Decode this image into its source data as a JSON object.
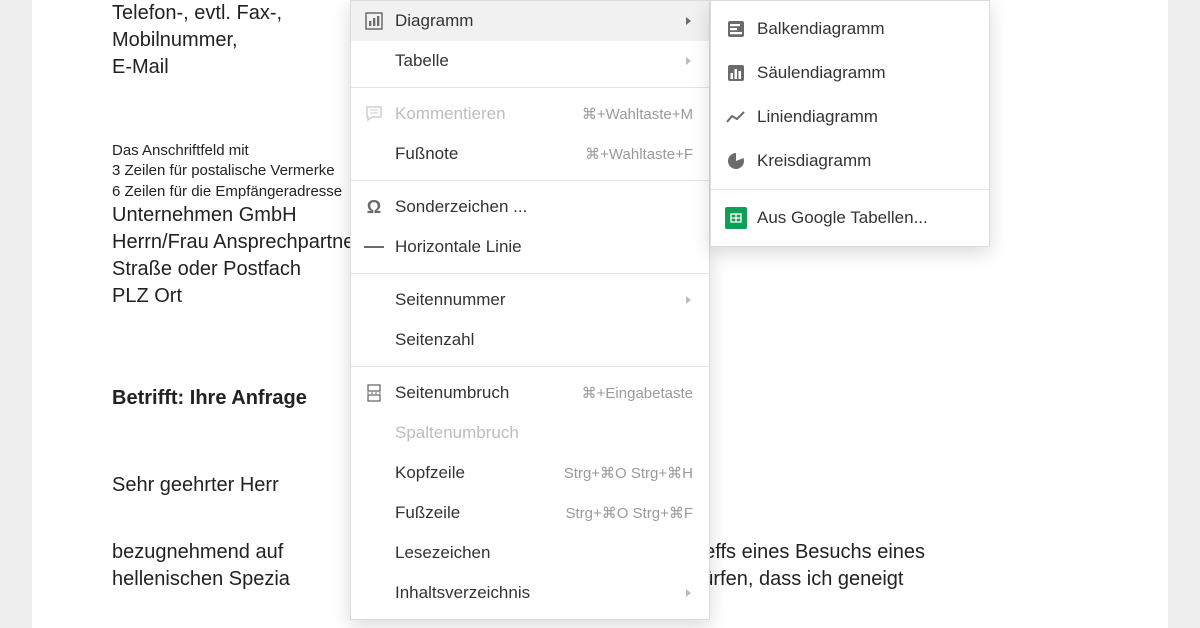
{
  "document": {
    "line1": "Telefon-, evtl. Fax-,",
    "line2": "Mobilnummer,",
    "line3": "E-Mail",
    "small1": "Das Anschriftfeld mit",
    "small2": "3 Zeilen für postalische Vermerke",
    "small3": "6 Zeilen für die Empfängeradresse",
    "addr1": "Unternehmen GmbH",
    "addr2": "Herrn/Frau Ansprechpartner",
    "addr3": "Straße oder Postfach",
    "addr4": "PLZ Ort",
    "subject": "Betrifft: Ihre Anfrage",
    "greeting": "Sehr geehrter Herr ",
    "body1": "bezugnehmend auf                                                    tigen Tage betreffs eines Besuchs eines",
    "body2": "hellenischen Spezia                                                  n mitteilen zu dürfen, dass ich geneigt"
  },
  "menu": {
    "diagramm": "Diagramm",
    "tabelle": "Tabelle",
    "kommentieren": "Kommentieren",
    "kommentieren_sc": "⌘+Wahltaste+M",
    "fussnote": "Fußnote",
    "fussnote_sc": "⌘+Wahltaste+F",
    "sonderzeichen": "Sonderzeichen ...",
    "hlinie": "Horizontale Linie",
    "seitennummer": "Seitennummer",
    "seitenzahl": "Seitenzahl",
    "seitenumbruch": "Seitenumbruch",
    "seitenumbruch_sc": "⌘+Eingabetaste",
    "spaltenumbruch": "Spaltenumbruch",
    "kopfzeile": "Kopfzeile",
    "kopfzeile_sc": "Strg+⌘O Strg+⌘H",
    "fusszeile": "Fußzeile",
    "fusszeile_sc": "Strg+⌘O Strg+⌘F",
    "lesezeichen": "Lesezeichen",
    "inhaltsverzeichnis": "Inhaltsverzeichnis"
  },
  "submenu": {
    "balken": "Balkendiagramm",
    "saeulen": "Säulendiagramm",
    "linien": "Liniendiagramm",
    "kreis": "Kreisdiagramm",
    "sheets": "Aus Google Tabellen..."
  }
}
